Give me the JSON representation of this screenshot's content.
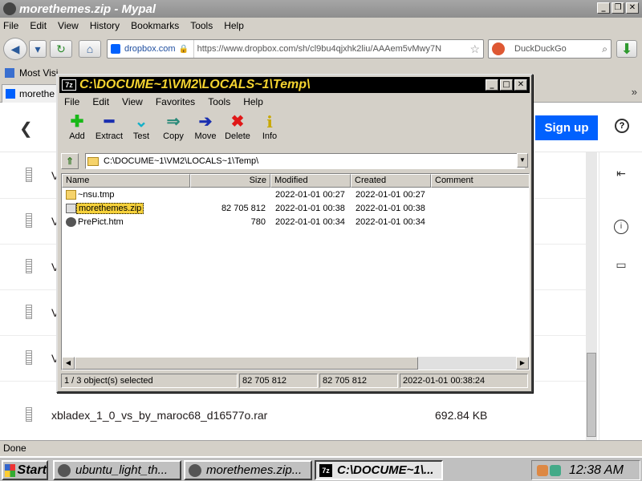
{
  "firefox": {
    "title": "morethemes.zip - Mypal",
    "menu": [
      "File",
      "Edit",
      "View",
      "History",
      "Bookmarks",
      "Tools",
      "Help"
    ],
    "url_site": "dropbox.com",
    "url": "https://www.dropbox.com/sh/cl9bu4qjxhk2liu/AAAem5vMwy7N",
    "search_placeholder": "DuckDuckGo",
    "bookmark": "Most Visi",
    "tab_title": "morethe",
    "tabs_more": "»",
    "status": "Done"
  },
  "dropbox": {
    "signup_label": "Sign up",
    "help_label": "?",
    "visible_row": {
      "name": "xbladex_1_0_vs_by_maroc68_d16577o.rar",
      "size": "692.84 KB"
    },
    "partial_row_prefix": "V"
  },
  "sevenzip": {
    "icon_label": "7z",
    "title": "C:\\DOCUME~1\\VM2\\LOCALS~1\\Temp\\",
    "menu": [
      "File",
      "Edit",
      "View",
      "Favorites",
      "Tools",
      "Help"
    ],
    "toolbar": [
      {
        "label": "Add",
        "icon": "add-icon",
        "glyph": "✚",
        "color": "#18b818"
      },
      {
        "label": "Extract",
        "icon": "extract-icon",
        "glyph": "━",
        "color": "#1a2fb0"
      },
      {
        "label": "Test",
        "icon": "test-icon",
        "glyph": "⌄",
        "color": "#14b0c8"
      },
      {
        "label": "Copy",
        "icon": "copy-icon",
        "glyph": "⇒",
        "color": "#2a8a7a"
      },
      {
        "label": "Move",
        "icon": "move-icon",
        "glyph": "➔",
        "color": "#1a2fb0"
      },
      {
        "label": "Delete",
        "icon": "delete-icon",
        "glyph": "✖",
        "color": "#e01818"
      },
      {
        "label": "Info",
        "icon": "info-icon",
        "glyph": "i",
        "color": "#c8a800"
      }
    ],
    "path": "C:\\DOCUME~1\\VM2\\LOCALS~1\\Temp\\",
    "columns": [
      "Name",
      "Size",
      "Modified",
      "Created",
      "Comment"
    ],
    "files": [
      {
        "name": "~nsu.tmp",
        "size": "",
        "modified": "2022-01-01 00:27",
        "created": "2022-01-01 00:27",
        "icon": "folder"
      },
      {
        "name": "morethemes.zip",
        "size": "82 705 812",
        "modified": "2022-01-01 00:38",
        "created": "2022-01-01 00:38",
        "icon": "zip"
      },
      {
        "name": "PrePict.htm",
        "size": "780",
        "modified": "2022-01-01 00:34",
        "created": "2022-01-01 00:34",
        "icon": "html"
      }
    ],
    "status": {
      "selected": "1 / 3 object(s) selected",
      "size": "82 705 812",
      "packed": "82 705 812",
      "modified": "2022-01-01 00:38:24"
    }
  },
  "taskbar": {
    "start": "Start",
    "tasks": [
      "ubuntu_light_th...",
      "morethemes.zip...",
      "C:\\DOCUME~1\\..."
    ],
    "clock": "12:38 AM"
  }
}
